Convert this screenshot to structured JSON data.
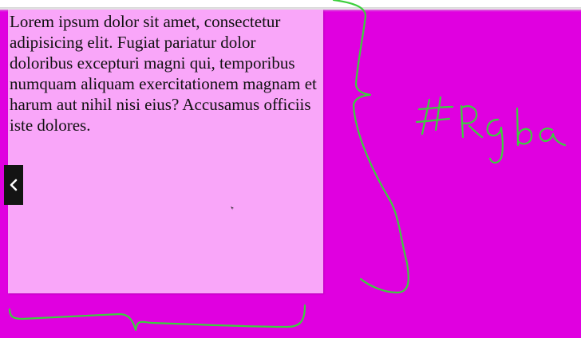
{
  "content": {
    "paragraph": "Lorem ipsum dolor sit amet, consectetur adipisicing elit. Fugiat pariatur dolor doloribus excepturi magni qui, temporibus numquam aliquam exercitationem magnam et harum aut nihil nisi eius? Accusamus officiis iste dolores."
  },
  "annotation": {
    "handwritten_label": "#rgba",
    "ink_color": "#3ccf3c"
  },
  "colors": {
    "page_background": "#e000e0",
    "inner_box": "#f9a6f9",
    "nav_button": "#141414"
  },
  "icons": {
    "nav_back": "chevron-left-icon",
    "pointer": "mouse-cursor-icon"
  }
}
